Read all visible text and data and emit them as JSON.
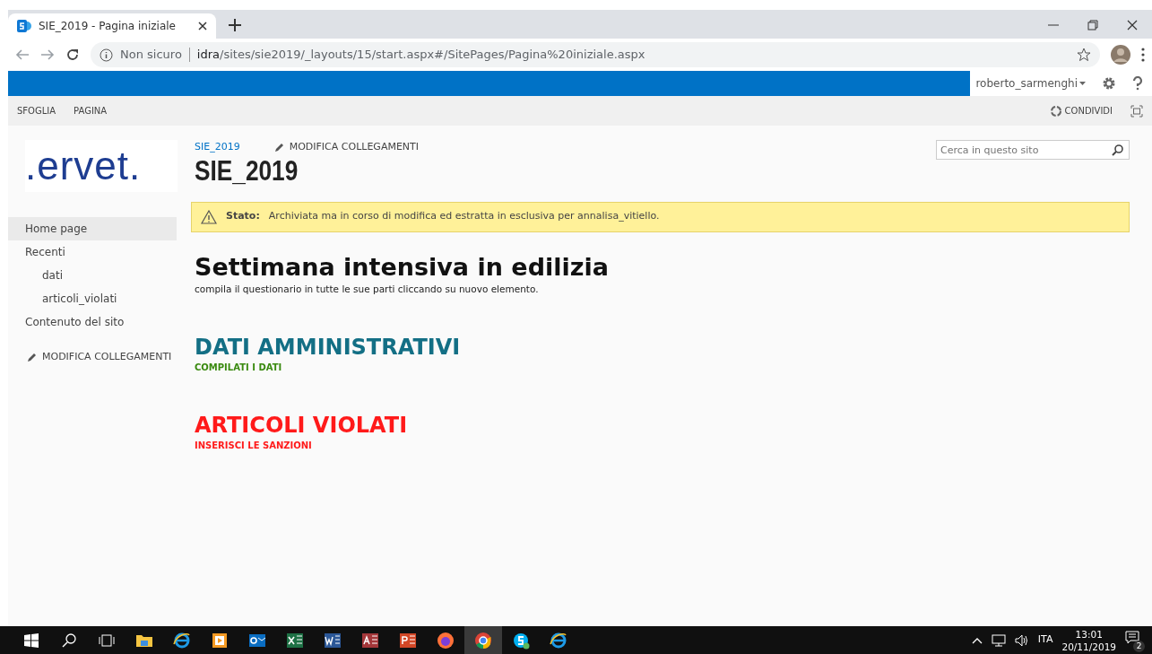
{
  "browser": {
    "tabs": [
      {
        "title": "SIE_2019 - Pagina iniziale",
        "selected": true
      }
    ],
    "address": {
      "security": "Non sicuro",
      "host": "idra",
      "path": "/sites/sie2019/_layouts/15/start.aspx#/SitePages/Pagina%20iniziale.aspx"
    }
  },
  "suite_bar": {
    "user": "roberto_sarmenghi"
  },
  "ribbon": {
    "tabs": [
      "SFOGLIA",
      "PAGINA"
    ],
    "share": "CONDIVIDI"
  },
  "site": {
    "logo": ".ervet.",
    "breadcrumb": "SIE_2019",
    "edit_links": "MODIFICA COLLEGAMENTI",
    "title": "SIE_2019",
    "search": {
      "placeholder": "Cerca in questo sito"
    }
  },
  "nav": {
    "items": [
      {
        "label": "Home page",
        "selected": true
      },
      {
        "label": "Recenti",
        "selected": false,
        "children": [
          {
            "label": "dati",
            "selected": false
          },
          {
            "label": "articoli_violati",
            "selected": false
          }
        ]
      },
      {
        "label": "Contenuto del sito",
        "selected": false
      }
    ],
    "edit_links": "MODIFICA COLLEGAMENTI"
  },
  "status": {
    "label": "Stato:",
    "text": "Archiviata ma in corso di modifica ed estratta in esclusiva per annalisa_vitiello."
  },
  "page": {
    "heading": "Settimana intensiva in edilizia",
    "intro": "compila il questionario  in tutte le sue parti cliccando su nuovo elemento.",
    "sections": [
      {
        "title": "DATI AMMINISTRATIVI",
        "color": "#136f85",
        "subtitle": {
          "text": "COMPILATI I DATI",
          "color": "#3a8a10"
        }
      },
      {
        "title": "ARTICOLI VIOLATI",
        "color": "#ff1a1a",
        "subtitle": {
          "text": "INSERISCI LE SANZIONI",
          "color": "#ff1a1a"
        }
      }
    ]
  },
  "taskbar": {
    "apps": [
      {
        "kind": "files",
        "selected": false
      },
      {
        "kind": "ie",
        "selected": false
      },
      {
        "kind": "media",
        "selected": false
      },
      {
        "kind": "outlook",
        "selected": false
      },
      {
        "kind": "excel",
        "selected": false
      },
      {
        "kind": "word",
        "selected": false
      },
      {
        "kind": "access",
        "selected": false
      },
      {
        "kind": "powerpoint",
        "selected": false
      },
      {
        "kind": "firefox",
        "selected": false
      },
      {
        "kind": "chrome",
        "selected": true
      },
      {
        "kind": "skype",
        "selected": false
      },
      {
        "kind": "ie",
        "selected": false
      }
    ],
    "language": "ITA",
    "time": "13:01",
    "date": "20/11/2019",
    "notifications": "2"
  }
}
